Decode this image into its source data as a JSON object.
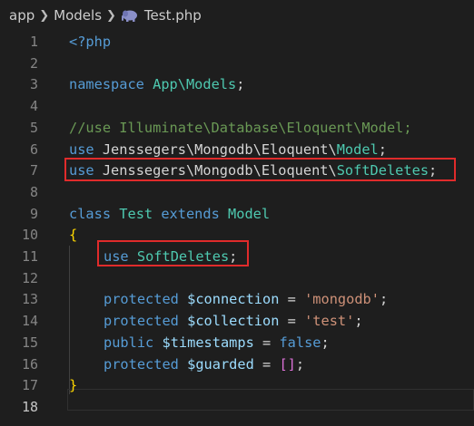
{
  "breadcrumb": {
    "items": [
      "app",
      "Models"
    ],
    "file": "Test.php",
    "file_icon": "php-elephant-icon"
  },
  "lines": [
    {
      "num": "1",
      "tokens": [
        [
          "kw",
          "<?php"
        ]
      ]
    },
    {
      "num": "2",
      "tokens": []
    },
    {
      "num": "3",
      "tokens": [
        [
          "kw",
          "namespace"
        ],
        [
          "pl",
          " "
        ],
        [
          "ns",
          "App\\Models"
        ],
        [
          "pl",
          ";"
        ]
      ]
    },
    {
      "num": "4",
      "tokens": []
    },
    {
      "num": "5",
      "tokens": [
        [
          "cm",
          "//use Illuminate\\Database\\Eloquent\\Model;"
        ]
      ]
    },
    {
      "num": "6",
      "tokens": [
        [
          "kw",
          "use"
        ],
        [
          "pl",
          " Jenssegers\\Mongodb\\Eloquent\\"
        ],
        [
          "ns",
          "Model"
        ],
        [
          "pl",
          ";"
        ]
      ]
    },
    {
      "num": "7",
      "tokens": [
        [
          "kw",
          "use"
        ],
        [
          "pl",
          " Jenssegers\\Mongodb\\Eloquent\\"
        ],
        [
          "ns",
          "SoftDeletes"
        ],
        [
          "pl",
          ";"
        ]
      ]
    },
    {
      "num": "8",
      "tokens": []
    },
    {
      "num": "9",
      "tokens": [
        [
          "kw",
          "class"
        ],
        [
          "pl",
          " "
        ],
        [
          "ns",
          "Test"
        ],
        [
          "pl",
          " "
        ],
        [
          "kw",
          "extends"
        ],
        [
          "pl",
          " "
        ],
        [
          "ns",
          "Model"
        ]
      ]
    },
    {
      "num": "10",
      "tokens": [
        [
          "br",
          "{"
        ]
      ]
    },
    {
      "num": "11",
      "tokens": [
        [
          "kw",
          "use"
        ],
        [
          "pl",
          " "
        ],
        [
          "ns",
          "SoftDeletes"
        ],
        [
          "pl",
          ";"
        ]
      ],
      "indent": true
    },
    {
      "num": "12",
      "tokens": []
    },
    {
      "num": "13",
      "tokens": [
        [
          "kw",
          "protected"
        ],
        [
          "pl",
          " "
        ],
        [
          "vr",
          "$connection"
        ],
        [
          "pl",
          " = "
        ],
        [
          "str",
          "'mongodb'"
        ],
        [
          "pl",
          ";"
        ]
      ],
      "indent": true
    },
    {
      "num": "14",
      "tokens": [
        [
          "kw",
          "protected"
        ],
        [
          "pl",
          " "
        ],
        [
          "vr",
          "$collection"
        ],
        [
          "pl",
          " = "
        ],
        [
          "str",
          "'test'"
        ],
        [
          "pl",
          ";"
        ]
      ],
      "indent": true
    },
    {
      "num": "15",
      "tokens": [
        [
          "kw",
          "public"
        ],
        [
          "pl",
          " "
        ],
        [
          "vr",
          "$timestamps"
        ],
        [
          "pl",
          " = "
        ],
        [
          "kw",
          "false"
        ],
        [
          "pl",
          ";"
        ]
      ],
      "indent": true
    },
    {
      "num": "16",
      "tokens": [
        [
          "kw",
          "protected"
        ],
        [
          "pl",
          " "
        ],
        [
          "vr",
          "$guarded"
        ],
        [
          "pl",
          " = "
        ],
        [
          "br2",
          "[]"
        ],
        [
          "pl",
          ";"
        ]
      ],
      "indent": true
    },
    {
      "num": "17",
      "tokens": [
        [
          "br",
          "}"
        ]
      ]
    },
    {
      "num": "18",
      "tokens": [],
      "active": true
    }
  ],
  "highlight_color": "#e02b2b"
}
